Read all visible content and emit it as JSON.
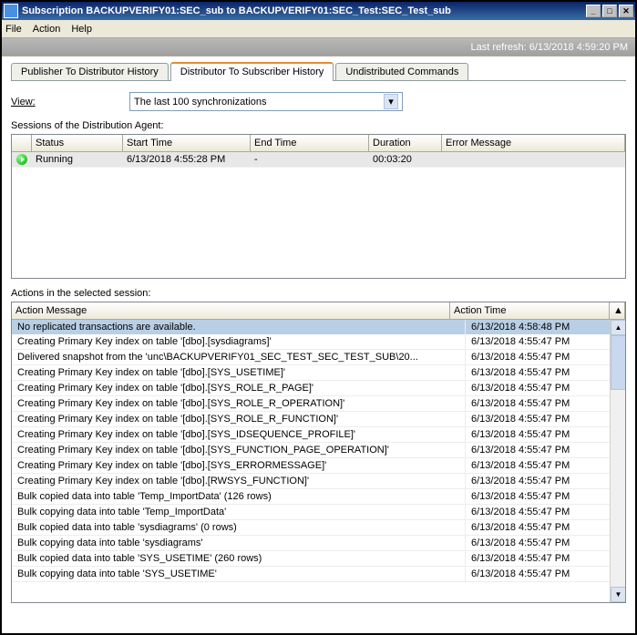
{
  "window": {
    "title": "Subscription BACKUPVERIFY01:SEC_sub to BACKUPVERIFY01:SEC_Test:SEC_Test_sub"
  },
  "menu": {
    "file": "File",
    "action": "Action",
    "help": "Help"
  },
  "statusbar": {
    "last_refresh": "Last refresh: 6/13/2018 4:59:20 PM"
  },
  "tabs": {
    "publisher": "Publisher To Distributor History",
    "distributor": "Distributor To Subscriber History",
    "undistributed": "Undistributed Commands"
  },
  "view": {
    "label": "View:",
    "selected": "The last 100 synchronizations"
  },
  "sessions": {
    "label": "Sessions of the Distribution Agent:",
    "headers": {
      "status": "Status",
      "start": "Start Time",
      "end": "End Time",
      "duration": "Duration",
      "error": "Error Message"
    },
    "rows": [
      {
        "status": "Running",
        "start": "6/13/2018 4:55:28 PM",
        "end": "-",
        "duration": "00:03:20",
        "error": ""
      }
    ]
  },
  "actions": {
    "label": "Actions in the selected session:",
    "headers": {
      "msg": "Action Message",
      "time": "Action Time"
    },
    "rows": [
      {
        "msg": "No replicated transactions are available.",
        "time": "6/13/2018 4:58:48 PM"
      },
      {
        "msg": "Creating Primary Key index on table '[dbo].[sysdiagrams]'",
        "time": "6/13/2018 4:55:47 PM"
      },
      {
        "msg": "Delivered snapshot from the 'unc\\BACKUPVERIFY01_SEC_TEST_SEC_TEST_SUB\\20...",
        "time": "6/13/2018 4:55:47 PM"
      },
      {
        "msg": "Creating Primary Key index on table '[dbo].[SYS_USETIME]'",
        "time": "6/13/2018 4:55:47 PM"
      },
      {
        "msg": "Creating Primary Key index on table '[dbo].[SYS_ROLE_R_PAGE]'",
        "time": "6/13/2018 4:55:47 PM"
      },
      {
        "msg": "Creating Primary Key index on table '[dbo].[SYS_ROLE_R_OPERATION]'",
        "time": "6/13/2018 4:55:47 PM"
      },
      {
        "msg": "Creating Primary Key index on table '[dbo].[SYS_ROLE_R_FUNCTION]'",
        "time": "6/13/2018 4:55:47 PM"
      },
      {
        "msg": "Creating Primary Key index on table '[dbo].[SYS_IDSEQUENCE_PROFILE]'",
        "time": "6/13/2018 4:55:47 PM"
      },
      {
        "msg": "Creating Primary Key index on table '[dbo].[SYS_FUNCTION_PAGE_OPERATION]'",
        "time": "6/13/2018 4:55:47 PM"
      },
      {
        "msg": "Creating Primary Key index on table '[dbo].[SYS_ERRORMESSAGE]'",
        "time": "6/13/2018 4:55:47 PM"
      },
      {
        "msg": "Creating Primary Key index on table '[dbo].[RWSYS_FUNCTION]'",
        "time": "6/13/2018 4:55:47 PM"
      },
      {
        "msg": "Bulk copied data into table 'Temp_ImportData' (126 rows)",
        "time": "6/13/2018 4:55:47 PM"
      },
      {
        "msg": "Bulk copying data into table 'Temp_ImportData'",
        "time": "6/13/2018 4:55:47 PM"
      },
      {
        "msg": "Bulk copied data into table 'sysdiagrams' (0 rows)",
        "time": "6/13/2018 4:55:47 PM"
      },
      {
        "msg": "Bulk copying data into table 'sysdiagrams'",
        "time": "6/13/2018 4:55:47 PM"
      },
      {
        "msg": "Bulk copied data into table 'SYS_USETIME' (260 rows)",
        "time": "6/13/2018 4:55:47 PM"
      },
      {
        "msg": "Bulk copying data into table 'SYS_USETIME'",
        "time": "6/13/2018 4:55:47 PM"
      }
    ]
  }
}
